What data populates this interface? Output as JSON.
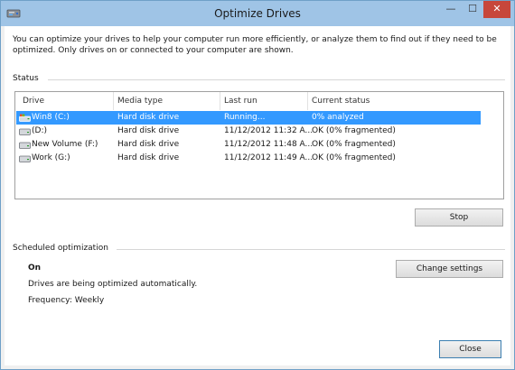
{
  "window": {
    "title": "Optimize Drives",
    "minimize_glyph": "—",
    "maximize_glyph": "☐",
    "close_glyph": "✕"
  },
  "intro": "You can optimize your drives to help your computer run more efficiently, or analyze them to find out if they need to be optimized. Only drives on or connected to your computer are shown.",
  "status": {
    "label": "Status",
    "columns": [
      "Drive",
      "Media type",
      "Last run",
      "Current status"
    ],
    "rows": [
      {
        "drive": "Win8 (C:)",
        "media": "Hard disk drive",
        "last_run": "Running...",
        "status": "0% analyzed",
        "icon": "system-drive-icon",
        "selected": true
      },
      {
        "drive": "(D:)",
        "media": "Hard disk drive",
        "last_run": "11/12/2012 11:32 A...",
        "status": "OK (0% fragmented)",
        "icon": "drive-icon",
        "selected": false
      },
      {
        "drive": "New Volume (F:)",
        "media": "Hard disk drive",
        "last_run": "11/12/2012 11:48 A...",
        "status": "OK (0% fragmented)",
        "icon": "drive-icon",
        "selected": false
      },
      {
        "drive": "Work (G:)",
        "media": "Hard disk drive",
        "last_run": "11/12/2012 11:49 A...",
        "status": "OK (0% fragmented)",
        "icon": "drive-icon",
        "selected": false
      }
    ],
    "stop_label": "Stop"
  },
  "scheduled": {
    "label": "Scheduled optimization",
    "state": "On",
    "description": "Drives are being optimized automatically.",
    "frequency": "Frequency: Weekly",
    "change_label": "Change settings"
  },
  "close_label": "Close",
  "colors": {
    "title_bar": "#9fc4e6",
    "selection": "#3399ff",
    "close_button": "#c7473b"
  }
}
